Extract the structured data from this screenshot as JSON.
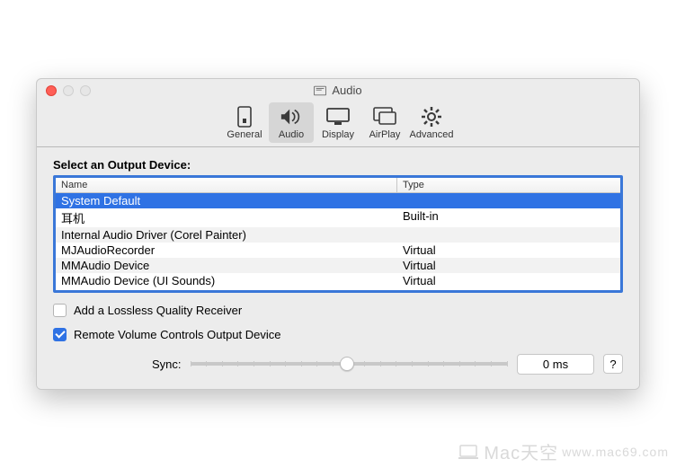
{
  "window": {
    "title": "Audio"
  },
  "toolbar": {
    "items": [
      {
        "label": "General"
      },
      {
        "label": "Audio"
      },
      {
        "label": "Display"
      },
      {
        "label": "AirPlay"
      },
      {
        "label": "Advanced"
      }
    ]
  },
  "section_label": "Select an Output Device:",
  "columns": {
    "name": "Name",
    "type": "Type"
  },
  "devices": [
    {
      "name": "System Default",
      "type": ""
    },
    {
      "name": "耳机",
      "type": "Built-in"
    },
    {
      "name": "Internal Audio Driver (Corel Painter)",
      "type": ""
    },
    {
      "name": "MJAudioRecorder",
      "type": "Virtual"
    },
    {
      "name": "MMAudio Device",
      "type": "Virtual"
    },
    {
      "name": "MMAudio Device (UI Sounds)",
      "type": "Virtual"
    }
  ],
  "checks": {
    "lossless": "Add a Lossless Quality Receiver",
    "remote": "Remote Volume Controls Output Device"
  },
  "sync": {
    "label": "Sync:",
    "value": "0 ms",
    "help": "?"
  },
  "watermark": {
    "text": "Mac天空",
    "sub": "www.mac69.com"
  }
}
